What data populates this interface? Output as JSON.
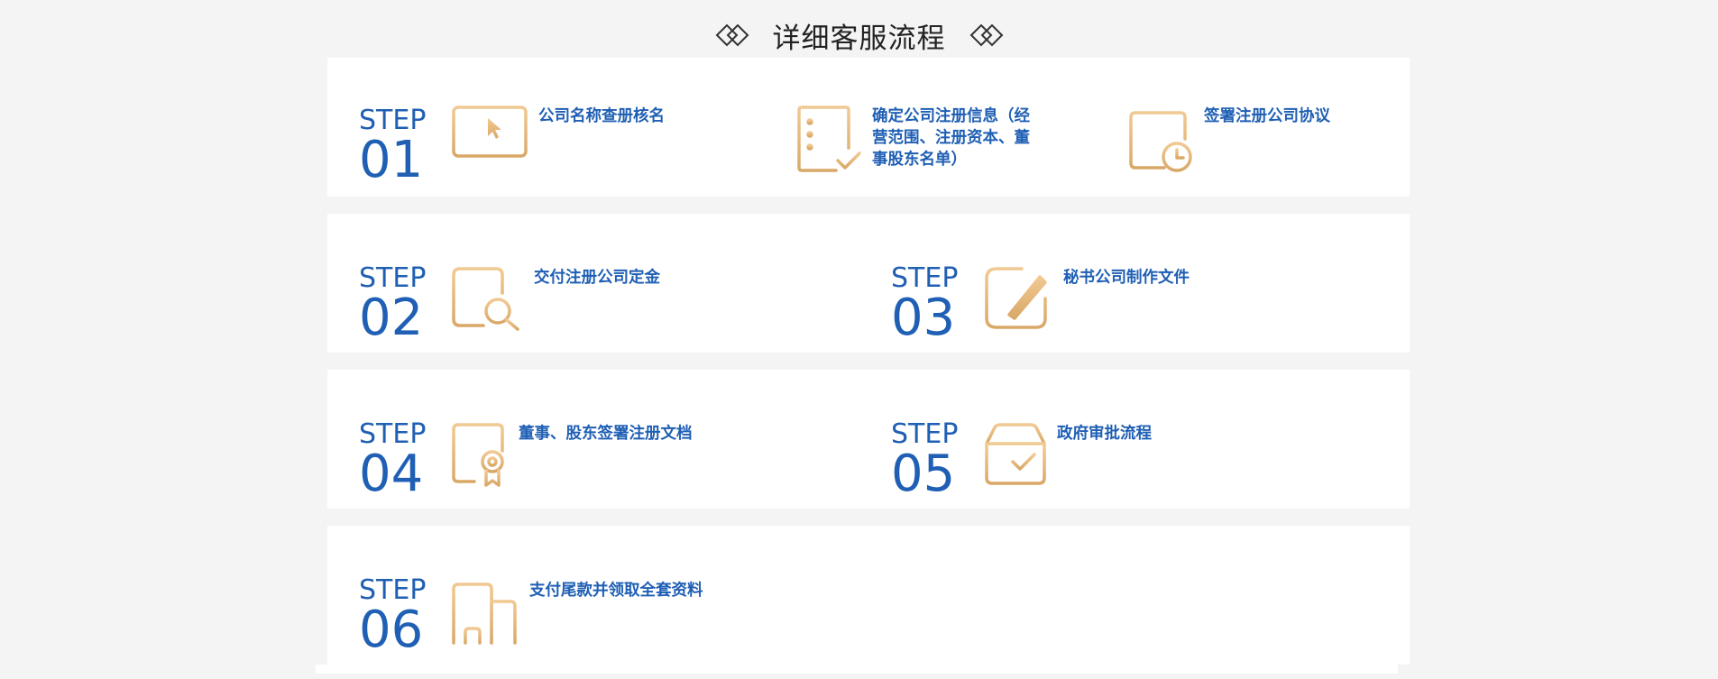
{
  "header": {
    "title": "详细客服流程"
  },
  "steps": [
    {
      "word": "STEP",
      "num": "01",
      "label": "公司名称查册核名",
      "icon": "monitor-icon"
    },
    {
      "word": "",
      "num": "",
      "label": "确定公司注册信息（经营范围、注册资本、董事股东名单）",
      "icon": "checklist-icon"
    },
    {
      "word": "",
      "num": "",
      "label": "签署注册公司协议",
      "icon": "calendar-clock-icon"
    },
    {
      "word": "STEP",
      "num": "02",
      "label": "交付注册公司定金",
      "icon": "document-search-icon"
    },
    {
      "word": "STEP",
      "num": "03",
      "label": "秘书公司制作文件",
      "icon": "edit-document-icon"
    },
    {
      "word": "STEP",
      "num": "04",
      "label": "董事、股东签署注册文档",
      "icon": "certificate-icon"
    },
    {
      "word": "STEP",
      "num": "05",
      "label": "政府审批流程",
      "icon": "approved-box-icon"
    },
    {
      "word": "STEP",
      "num": "06",
      "label": "支付尾款并领取全套资料",
      "icon": "buildings-icon"
    }
  ],
  "colors": {
    "step_blue": "#1f5fb4",
    "icon_gold": "#e2b57a",
    "panel_bg": "#ffffff",
    "page_bg": "#f4f4f4"
  }
}
